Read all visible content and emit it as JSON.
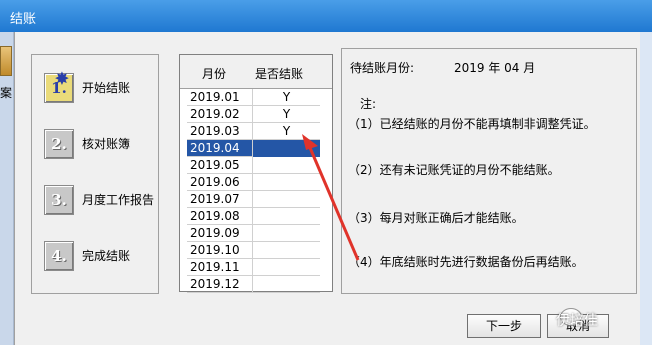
{
  "window": {
    "title": "结账"
  },
  "background": {
    "left_char": "案"
  },
  "steps": [
    {
      "number": "1.",
      "label": "开始结账",
      "active": true
    },
    {
      "number": "2.",
      "label": "核对账簿",
      "active": false
    },
    {
      "number": "3.",
      "label": "月度工作报告",
      "active": false
    },
    {
      "number": "4.",
      "label": "完成结账",
      "active": false
    }
  ],
  "table": {
    "headers": [
      "月份",
      "是否结账"
    ],
    "rows": [
      {
        "month": "2019.01",
        "closed": "Y"
      },
      {
        "month": "2019.02",
        "closed": "Y"
      },
      {
        "month": "2019.03",
        "closed": "Y"
      },
      {
        "month": "2019.04",
        "closed": "",
        "selected": true
      },
      {
        "month": "2019.05",
        "closed": ""
      },
      {
        "month": "2019.06",
        "closed": ""
      },
      {
        "month": "2019.07",
        "closed": ""
      },
      {
        "month": "2019.08",
        "closed": ""
      },
      {
        "month": "2019.09",
        "closed": ""
      },
      {
        "month": "2019.10",
        "closed": ""
      },
      {
        "month": "2019.11",
        "closed": ""
      },
      {
        "month": "2019.12",
        "closed": ""
      }
    ]
  },
  "info": {
    "pending_label": "待结账月份:",
    "pending_value": "2019 年 04 月",
    "note_title": "注:",
    "notes": [
      "（1）已经结账的月份不能再填制非调整凭证。",
      "（2）还有未记账凭证的月份不能结账。",
      "（3）每月对账正确后才能结账。",
      "（4）年底结账时先进行数据备份后再结账。"
    ]
  },
  "buttons": {
    "next": "下一步",
    "cancel": "取消"
  },
  "watermark": "伊培佳",
  "colors": {
    "selection": "#2456a6",
    "arrow": "#e0332a",
    "titlebar": "#1f78d1"
  }
}
